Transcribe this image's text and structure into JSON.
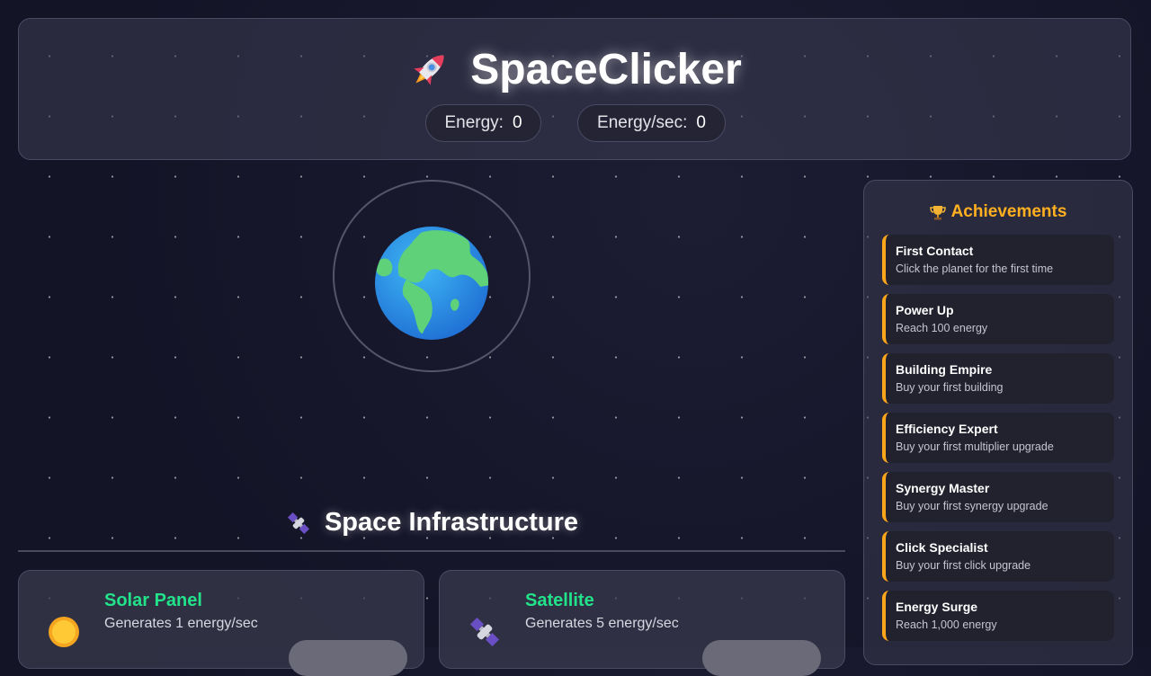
{
  "header": {
    "title": "SpaceClicker",
    "energy_label": "Energy:",
    "energy_value": "0",
    "rate_label": "Energy/sec:",
    "rate_value": "0"
  },
  "infrastructure": {
    "title": "Space Infrastructure",
    "buildings": [
      {
        "name": "Solar Panel",
        "desc": "Generates 1 energy/sec",
        "icon": "sun-icon"
      },
      {
        "name": "Satellite",
        "desc": "Generates 5 energy/sec",
        "icon": "satellite-icon"
      }
    ]
  },
  "achievements": {
    "title": "Achievements",
    "items": [
      {
        "name": "First Contact",
        "desc": "Click the planet for the first time"
      },
      {
        "name": "Power Up",
        "desc": "Reach 100 energy"
      },
      {
        "name": "Building Empire",
        "desc": "Buy your first building"
      },
      {
        "name": "Efficiency Expert",
        "desc": "Buy your first multiplier upgrade"
      },
      {
        "name": "Synergy Master",
        "desc": "Buy your first synergy upgrade"
      },
      {
        "name": "Click Specialist",
        "desc": "Buy your first click upgrade"
      },
      {
        "name": "Energy Surge",
        "desc": "Reach 1,000 energy"
      }
    ]
  },
  "colors": {
    "accent_green": "#22e28a",
    "achievement_gold": "#ffb020"
  }
}
